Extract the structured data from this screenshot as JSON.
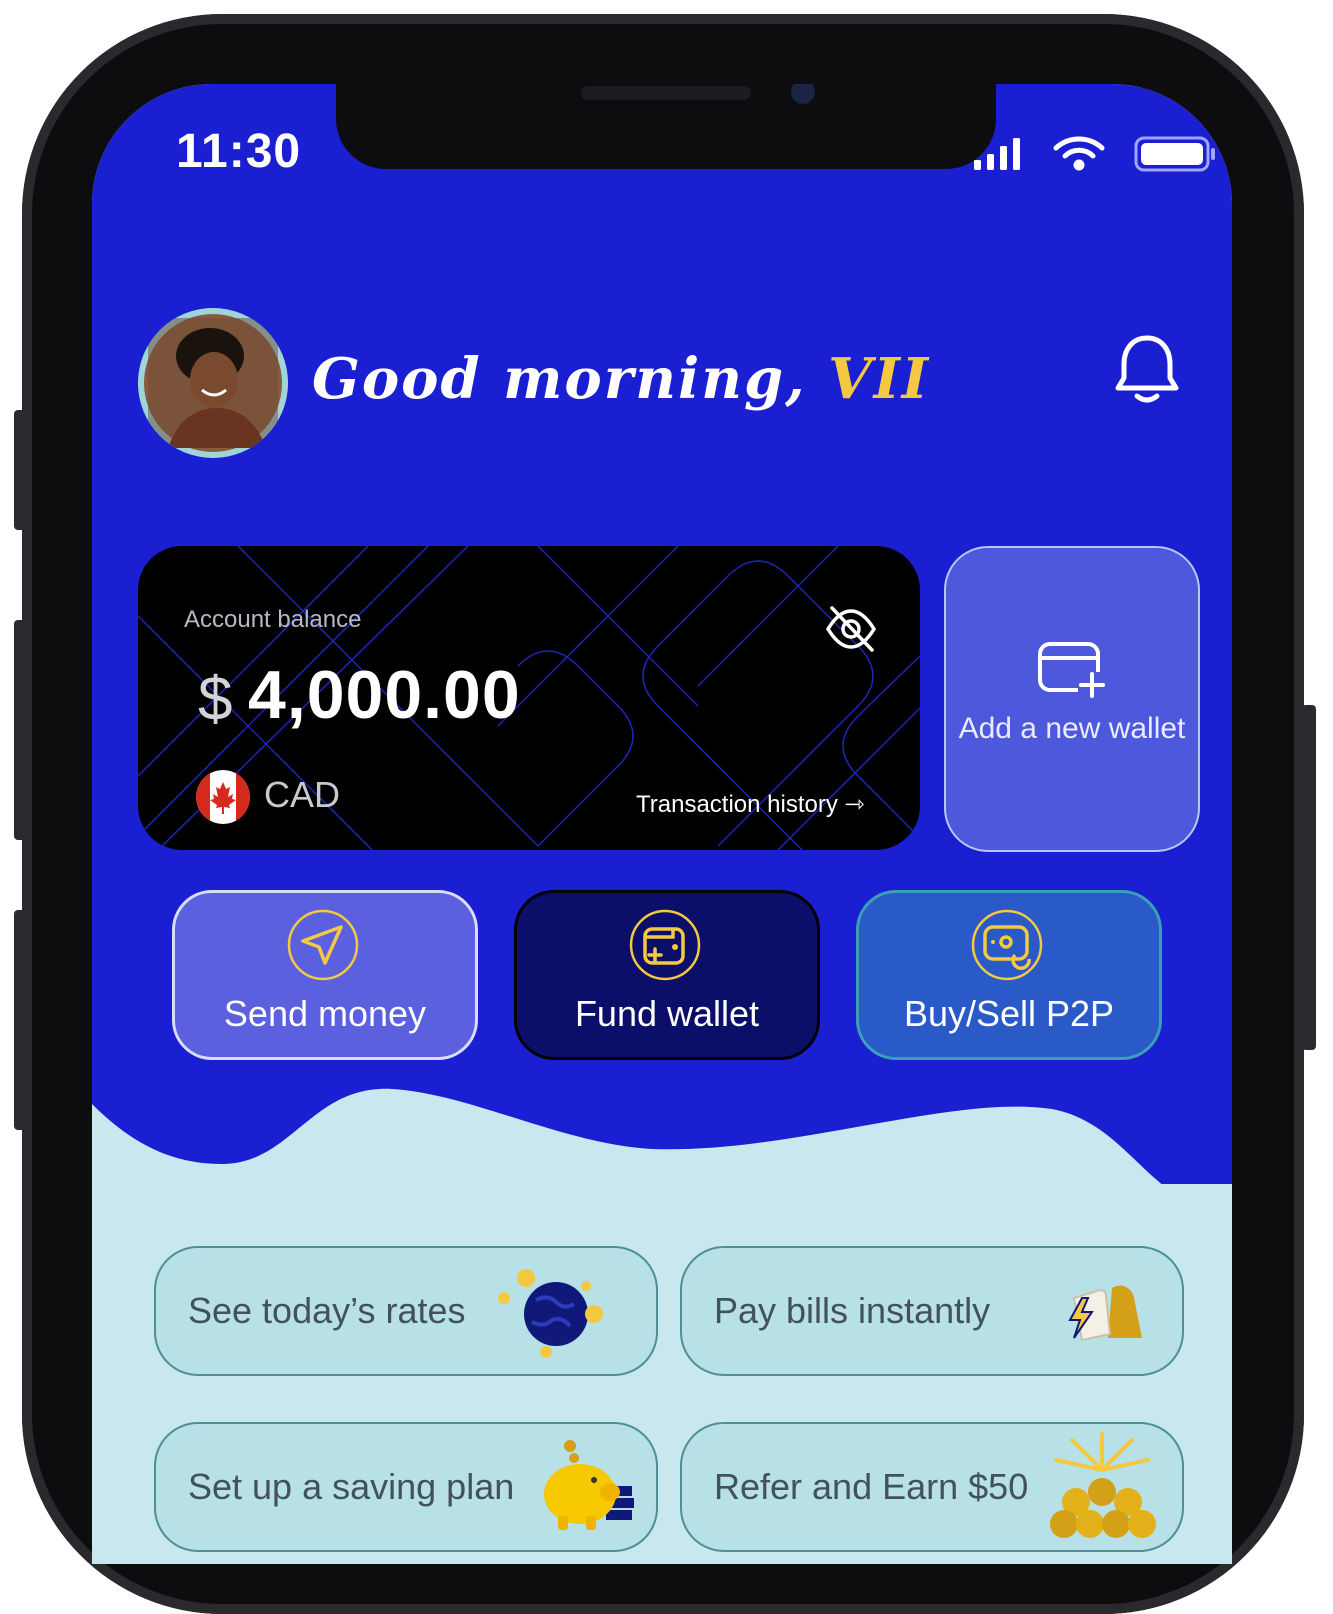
{
  "status_bar": {
    "time": "11:30"
  },
  "header": {
    "greeting_prefix": "Good morning,",
    "user_name": "VII"
  },
  "balance_card": {
    "label": "Account balance",
    "currency_symbol": "$",
    "amount": "4,000.00",
    "currency_code": "CAD",
    "history_link": "Transaction history ⇾"
  },
  "add_wallet": {
    "label": "Add a new wallet"
  },
  "actions": {
    "send": "Send money",
    "fund": "Fund wallet",
    "p2p": "Buy/Sell P2P"
  },
  "quick_links": {
    "rates": "See today’s rates",
    "bills": "Pay bills instantly",
    "saving": "Set up a saving plan",
    "refer": "Refer and Earn $50"
  },
  "colors": {
    "primary_blue": "#1a1fd2",
    "accent_yellow": "#f5c842",
    "card_black": "#000000",
    "light_teal": "#c9e7ee"
  }
}
